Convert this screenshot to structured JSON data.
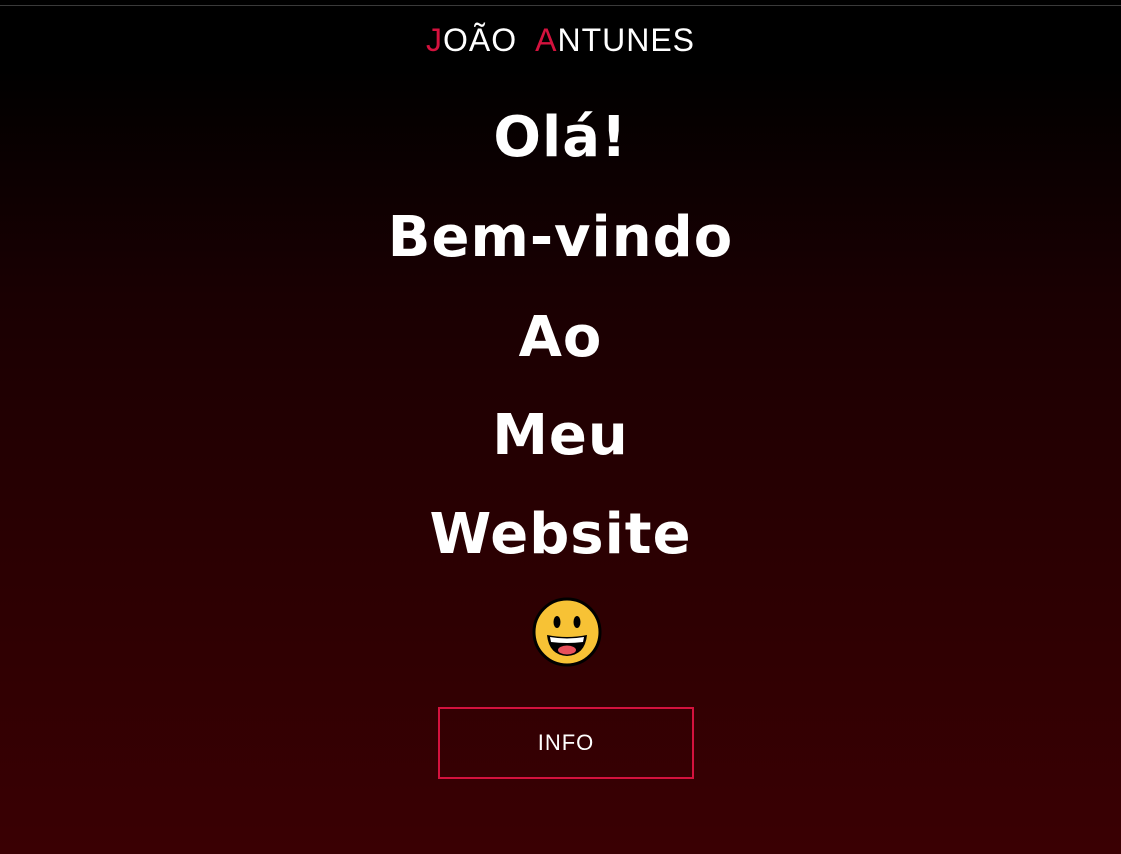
{
  "header": {
    "brand_first_initial": "J",
    "brand_first_rest": "OÃO",
    "brand_last_initial": "A",
    "brand_last_rest": "NTUNES",
    "accent_color": "#d4123e"
  },
  "hero": {
    "lines": [
      "Olá!",
      "Bem-vindo",
      "Ao",
      "Meu",
      "Website"
    ],
    "emoji_icon": "grinning-face-icon"
  },
  "info_button": {
    "label": "INFO",
    "border_color": "#d4123e"
  },
  "colors": {
    "background_top": "#000000",
    "background_bottom": "#3a0003",
    "text": "#ffffff"
  }
}
